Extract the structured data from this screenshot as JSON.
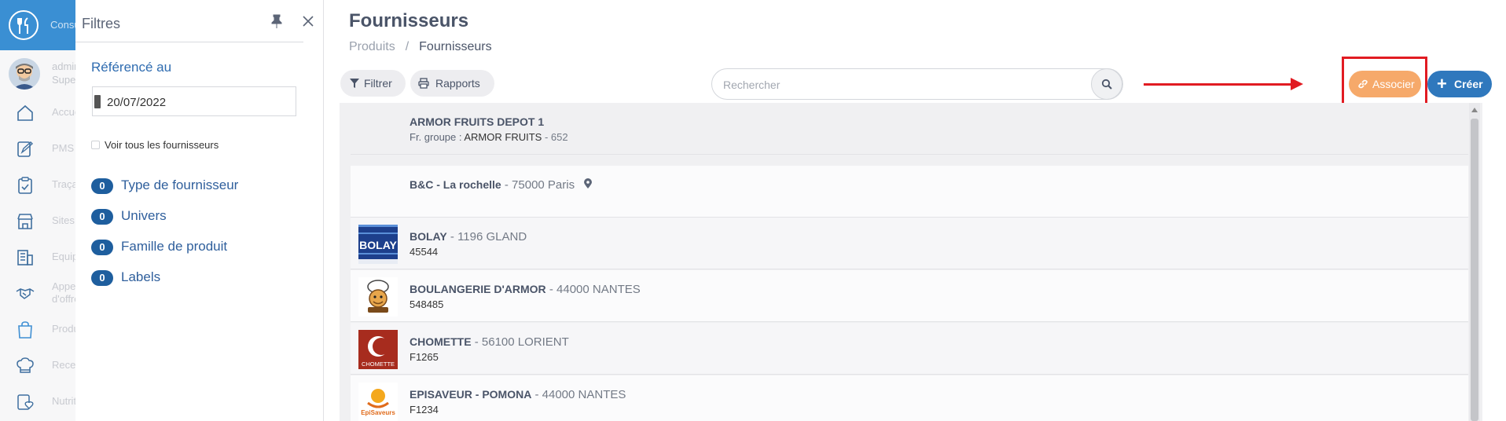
{
  "rail": {
    "logo_text": "Consulter",
    "user": [
      "admin",
      "Superv..."
    ],
    "items": [
      {
        "label": "Accueil",
        "icon": "home-icon"
      },
      {
        "label": "PMS",
        "icon": "edit-icon"
      },
      {
        "label": "Traçab...",
        "icon": "clipboard-icon"
      },
      {
        "label": "Sites",
        "icon": "store-icon"
      },
      {
        "label": "Equipe...",
        "icon": "building-icon"
      },
      {
        "label": "Appels d'offres",
        "icon": "handshake-icon"
      },
      {
        "label": "Produits",
        "icon": "bag-icon"
      },
      {
        "label": "Recette",
        "icon": "chef-hat-icon"
      },
      {
        "label": "Nutritio...",
        "icon": "heart-list-icon"
      }
    ],
    "accent": "#3a8fd3"
  },
  "filters": {
    "title": "Filtres",
    "ref_label": "Référencé au",
    "date_value": "20/07/2022",
    "see_all_label": "Voir tous les fournisseurs",
    "facets": [
      {
        "count": "0",
        "label": "Type de fournisseur"
      },
      {
        "count": "0",
        "label": "Univers"
      },
      {
        "count": "0",
        "label": "Famille de produit"
      },
      {
        "count": "0",
        "label": "Labels"
      }
    ]
  },
  "main": {
    "title": "Fournisseurs",
    "breadcrumb": {
      "parent": "Produits",
      "sep": "/",
      "current": "Fournisseurs"
    },
    "toolbar": {
      "filter_label": "Filtrer",
      "reports_label": "Rapports"
    },
    "search": {
      "placeholder": "Rechercher"
    },
    "associate_label": "Associer",
    "create_label": "Créer",
    "colors": {
      "associate": "#f6a96a",
      "create": "#2f78bd",
      "annotation": "#e11b22"
    },
    "suppliers": [
      {
        "name": "ARMOR FRUITS DEPOT 1",
        "sep": "",
        "location": "",
        "sub_key": "Fr. groupe : ",
        "sub_value": "ARMOR FRUITS",
        "sub_extra": " - 652",
        "logo": ""
      },
      {
        "name": "B&C - La rochelle",
        "sep": " - ",
        "location": "75000 Paris",
        "sub_key": "",
        "sub_value": "",
        "sub_extra": "",
        "logo": "",
        "pin": true
      },
      {
        "name": "BOLAY",
        "sep": " - ",
        "location": "1196 GLAND",
        "sub_key": "",
        "sub_value": "45544",
        "sub_extra": "",
        "logo": "bolay-logo"
      },
      {
        "name": "BOULANGERIE D'ARMOR",
        "sep": " - ",
        "location": "44000 NANTES",
        "sub_key": "",
        "sub_value": "548485",
        "sub_extra": "",
        "logo": "boulangerie-logo"
      },
      {
        "name": "CHOMETTE",
        "sep": " - ",
        "location": "56100 LORIENT",
        "sub_key": "",
        "sub_value": "F1265",
        "sub_extra": "",
        "logo": "chomette-logo"
      },
      {
        "name": "EPISAVEUR - POMONA",
        "sep": " - ",
        "location": "44000 NANTES",
        "sub_key": "",
        "sub_value": "F1234",
        "sub_extra": "",
        "logo": "episaveur-logo"
      }
    ],
    "logo_text": {
      "bolay": "BOLAY",
      "chomette": "CHOMETTE",
      "episaveur": "EpiSaveurs"
    }
  }
}
